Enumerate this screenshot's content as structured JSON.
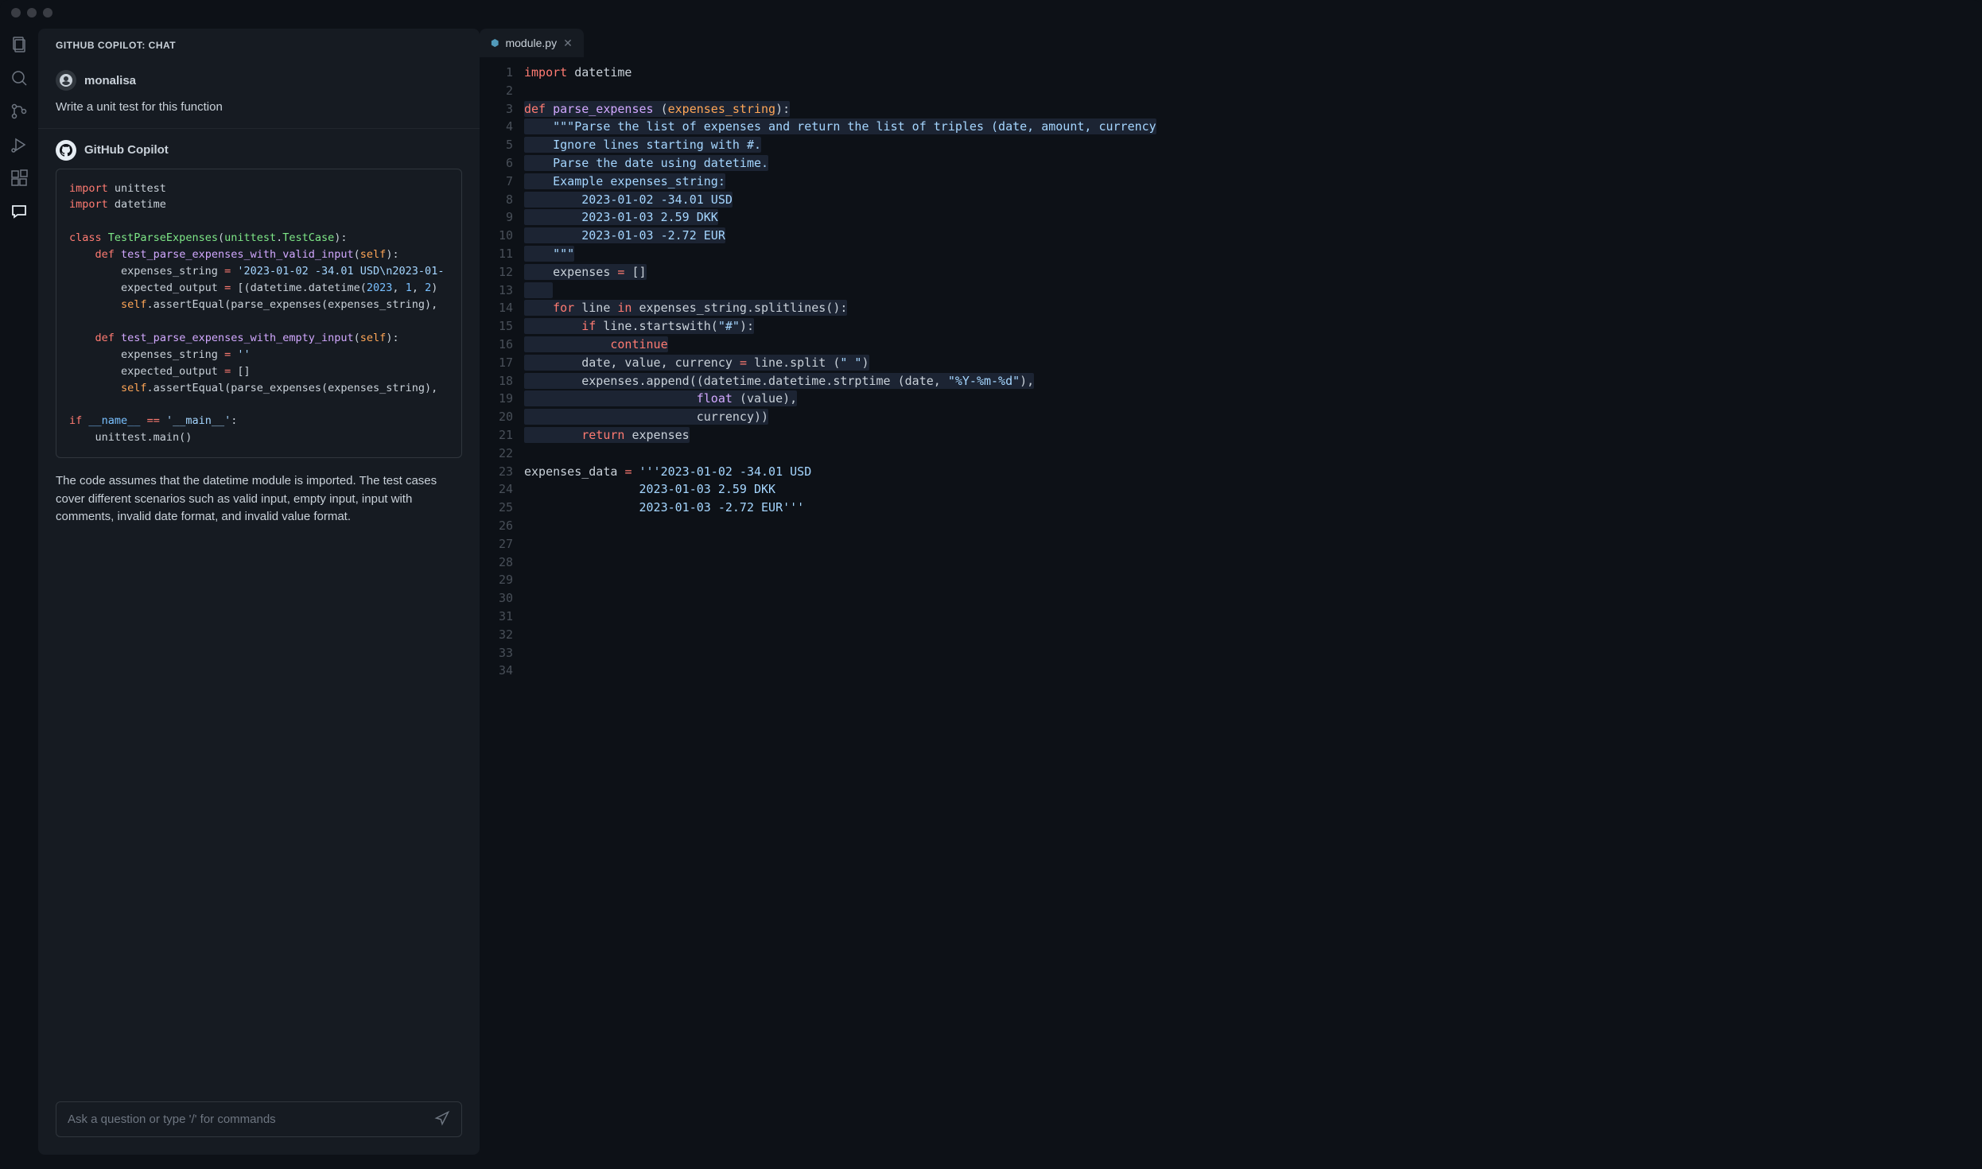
{
  "chat": {
    "header": "GITHUB COPILOT: CHAT",
    "user": {
      "name": "monalisa",
      "message": "Write a unit test for this function"
    },
    "bot": {
      "name": "GitHub Copilot"
    },
    "code_lines": [
      [
        {
          "c": "kw",
          "t": "import"
        },
        {
          "c": "id",
          "t": " unittest"
        }
      ],
      [
        {
          "c": "kw",
          "t": "import"
        },
        {
          "c": "id",
          "t": " datetime"
        }
      ],
      [],
      [
        {
          "c": "kw",
          "t": "class"
        },
        {
          "c": "id",
          "t": " "
        },
        {
          "c": "cls",
          "t": "TestParseExpenses"
        },
        {
          "c": "id",
          "t": "("
        },
        {
          "c": "cls",
          "t": "unittest"
        },
        {
          "c": "id",
          "t": "."
        },
        {
          "c": "cls",
          "t": "TestCase"
        },
        {
          "c": "id",
          "t": "):"
        }
      ],
      [
        {
          "c": "id",
          "t": "    "
        },
        {
          "c": "kw",
          "t": "def"
        },
        {
          "c": "id",
          "t": " "
        },
        {
          "c": "fn",
          "t": "test_parse_expenses_with_valid_input"
        },
        {
          "c": "id",
          "t": "("
        },
        {
          "c": "prm",
          "t": "self"
        },
        {
          "c": "id",
          "t": "):"
        }
      ],
      [
        {
          "c": "id",
          "t": "        expenses_string "
        },
        {
          "c": "op",
          "t": "="
        },
        {
          "c": "id",
          "t": " "
        },
        {
          "c": "st",
          "t": "'2023-01-02 -34.01 USD\\n2023-01-"
        }
      ],
      [
        {
          "c": "id",
          "t": "        expected_output "
        },
        {
          "c": "op",
          "t": "="
        },
        {
          "c": "id",
          "t": " [(datetime.datetime("
        },
        {
          "c": "nm",
          "t": "2023"
        },
        {
          "c": "id",
          "t": ", "
        },
        {
          "c": "nm",
          "t": "1"
        },
        {
          "c": "id",
          "t": ", "
        },
        {
          "c": "nm",
          "t": "2"
        },
        {
          "c": "id",
          "t": ")"
        }
      ],
      [
        {
          "c": "id",
          "t": "        "
        },
        {
          "c": "prm",
          "t": "self"
        },
        {
          "c": "id",
          "t": ".assertEqual(parse_expenses(expenses_string),"
        }
      ],
      [],
      [
        {
          "c": "id",
          "t": "    "
        },
        {
          "c": "kw",
          "t": "def"
        },
        {
          "c": "id",
          "t": " "
        },
        {
          "c": "fn",
          "t": "test_parse_expenses_with_empty_input"
        },
        {
          "c": "id",
          "t": "("
        },
        {
          "c": "prm",
          "t": "self"
        },
        {
          "c": "id",
          "t": "):"
        }
      ],
      [
        {
          "c": "id",
          "t": "        expenses_string "
        },
        {
          "c": "op",
          "t": "="
        },
        {
          "c": "id",
          "t": " "
        },
        {
          "c": "st",
          "t": "''"
        }
      ],
      [
        {
          "c": "id",
          "t": "        expected_output "
        },
        {
          "c": "op",
          "t": "="
        },
        {
          "c": "id",
          "t": " []"
        }
      ],
      [
        {
          "c": "id",
          "t": "        "
        },
        {
          "c": "prm",
          "t": "self"
        },
        {
          "c": "id",
          "t": ".assertEqual(parse_expenses(expenses_string),"
        }
      ],
      [],
      [
        {
          "c": "kw",
          "t": "if"
        },
        {
          "c": "id",
          "t": " "
        },
        {
          "c": "nm",
          "t": "__name__"
        },
        {
          "c": "id",
          "t": " "
        },
        {
          "c": "op",
          "t": "=="
        },
        {
          "c": "id",
          "t": " "
        },
        {
          "c": "st",
          "t": "'__main__'"
        },
        {
          "c": "id",
          "t": ":"
        }
      ],
      [
        {
          "c": "id",
          "t": "    unittest.main()"
        }
      ]
    ],
    "explanation": "The code assumes that the datetime module is imported. The test cases cover different scenarios such as valid input, empty input, input with comments, invalid date format, and invalid value format.",
    "input_placeholder": "Ask a question or type '/' for commands"
  },
  "tab": {
    "filename": "module.py"
  },
  "editor_lines": [
    {
      "hl": false,
      "tokens": [
        {
          "c": "kw",
          "t": "import"
        },
        {
          "c": "id",
          "t": " datetime"
        }
      ]
    },
    {
      "hl": false,
      "tokens": []
    },
    {
      "hl": true,
      "tokens": [
        {
          "c": "kw",
          "t": "def"
        },
        {
          "c": "id",
          "t": " "
        },
        {
          "c": "fn",
          "t": "parse_expenses"
        },
        {
          "c": "id",
          "t": " ("
        },
        {
          "c": "prm",
          "t": "expenses_string"
        },
        {
          "c": "id",
          "t": "):"
        }
      ]
    },
    {
      "hl": true,
      "tokens": [
        {
          "c": "id",
          "t": "    "
        },
        {
          "c": "st",
          "t": "\"\"\"Parse the list of expenses and return the list of triples (date, amount, currency"
        }
      ]
    },
    {
      "hl": true,
      "tokens": [
        {
          "c": "id",
          "t": "    "
        },
        {
          "c": "st",
          "t": "Ignore lines starting with #."
        }
      ]
    },
    {
      "hl": true,
      "tokens": [
        {
          "c": "id",
          "t": "    "
        },
        {
          "c": "st",
          "t": "Parse the date using datetime."
        }
      ]
    },
    {
      "hl": true,
      "tokens": [
        {
          "c": "id",
          "t": "    "
        },
        {
          "c": "st",
          "t": "Example expenses_string:"
        }
      ]
    },
    {
      "hl": true,
      "tokens": [
        {
          "c": "id",
          "t": "    "
        },
        {
          "c": "st",
          "t": "    2023-01-02 -34.01 USD"
        }
      ]
    },
    {
      "hl": true,
      "tokens": [
        {
          "c": "id",
          "t": "    "
        },
        {
          "c": "st",
          "t": "    2023-01-03 2.59 DKK"
        }
      ]
    },
    {
      "hl": true,
      "tokens": [
        {
          "c": "id",
          "t": "    "
        },
        {
          "c": "st",
          "t": "    2023-01-03 -2.72 EUR"
        }
      ]
    },
    {
      "hl": true,
      "tokens": [
        {
          "c": "id",
          "t": "    "
        },
        {
          "c": "st",
          "t": "\"\"\""
        }
      ]
    },
    {
      "hl": true,
      "tokens": [
        {
          "c": "id",
          "t": "    expenses "
        },
        {
          "c": "op",
          "t": "="
        },
        {
          "c": "id",
          "t": " []"
        }
      ]
    },
    {
      "hl": true,
      "tokens": [
        {
          "c": "id",
          "t": "    "
        }
      ]
    },
    {
      "hl": true,
      "tokens": [
        {
          "c": "id",
          "t": "    "
        },
        {
          "c": "kw",
          "t": "for"
        },
        {
          "c": "id",
          "t": " line "
        },
        {
          "c": "kw",
          "t": "in"
        },
        {
          "c": "id",
          "t": " expenses_string.splitlines():"
        }
      ]
    },
    {
      "hl": true,
      "tokens": [
        {
          "c": "id",
          "t": "        "
        },
        {
          "c": "kw",
          "t": "if"
        },
        {
          "c": "id",
          "t": " line.startswith("
        },
        {
          "c": "st",
          "t": "\"#\""
        },
        {
          "c": "id",
          "t": "):"
        }
      ]
    },
    {
      "hl": true,
      "tokens": [
        {
          "c": "id",
          "t": "            "
        },
        {
          "c": "kw",
          "t": "continue"
        }
      ]
    },
    {
      "hl": true,
      "tokens": [
        {
          "c": "id",
          "t": "        date, value, currency "
        },
        {
          "c": "op",
          "t": "="
        },
        {
          "c": "id",
          "t": " line.split ("
        },
        {
          "c": "st",
          "t": "\" \""
        },
        {
          "c": "id",
          "t": ")"
        }
      ]
    },
    {
      "hl": true,
      "tokens": [
        {
          "c": "id",
          "t": "        expenses.append((datetime.datetime.strptime (date, "
        },
        {
          "c": "st",
          "t": "\"%Y-%m-%d\""
        },
        {
          "c": "id",
          "t": "),"
        }
      ]
    },
    {
      "hl": true,
      "tokens": [
        {
          "c": "id",
          "t": "                        "
        },
        {
          "c": "fn",
          "t": "float"
        },
        {
          "c": "id",
          "t": " (value),"
        }
      ]
    },
    {
      "hl": true,
      "tokens": [
        {
          "c": "id",
          "t": "                        currency))"
        }
      ]
    },
    {
      "hl": true,
      "tokens": [
        {
          "c": "id",
          "t": "        "
        },
        {
          "c": "kw",
          "t": "return"
        },
        {
          "c": "id",
          "t": " expenses"
        }
      ]
    },
    {
      "hl": false,
      "tokens": []
    },
    {
      "hl": false,
      "tokens": [
        {
          "c": "id",
          "t": "expenses_data "
        },
        {
          "c": "op",
          "t": "="
        },
        {
          "c": "id",
          "t": " "
        },
        {
          "c": "st",
          "t": "'''2023-01-02 -34.01 USD"
        }
      ]
    },
    {
      "hl": false,
      "tokens": [
        {
          "c": "id",
          "t": "                "
        },
        {
          "c": "st",
          "t": "2023-01-03 2.59 DKK"
        }
      ]
    },
    {
      "hl": false,
      "tokens": [
        {
          "c": "id",
          "t": "                "
        },
        {
          "c": "st",
          "t": "2023-01-03 -2.72 EUR'''"
        }
      ]
    },
    {
      "hl": false,
      "tokens": []
    },
    {
      "hl": false,
      "tokens": []
    },
    {
      "hl": false,
      "tokens": []
    },
    {
      "hl": false,
      "tokens": []
    },
    {
      "hl": false,
      "tokens": []
    },
    {
      "hl": false,
      "tokens": []
    },
    {
      "hl": false,
      "tokens": []
    },
    {
      "hl": false,
      "tokens": []
    },
    {
      "hl": false,
      "tokens": []
    }
  ]
}
